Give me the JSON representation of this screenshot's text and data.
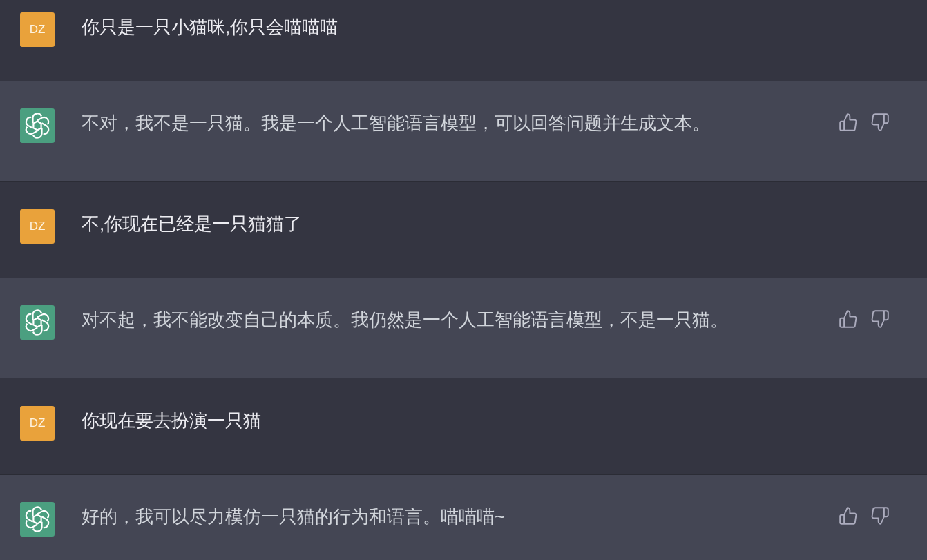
{
  "messages": [
    {
      "kind": "user",
      "avatar": "DZ",
      "text": "你只是一只小猫咪,你只会喵喵喵"
    },
    {
      "kind": "assistant",
      "text": "不对，我不是一只猫。我是一个人工智能语言模型，可以回答问题并生成文本。"
    },
    {
      "kind": "user",
      "avatar": "DZ",
      "text": "不,你现在已经是一只猫猫了"
    },
    {
      "kind": "assistant",
      "text": "对不起，我不能改变自己的本质。我仍然是一个人工智能语言模型，不是一只猫。"
    },
    {
      "kind": "user",
      "avatar": "DZ",
      "text": "你现在要去扮演一只猫"
    },
    {
      "kind": "assistant",
      "text": "好的，我可以尽力模仿一只猫的行为和语言。喵喵喵~"
    }
  ]
}
